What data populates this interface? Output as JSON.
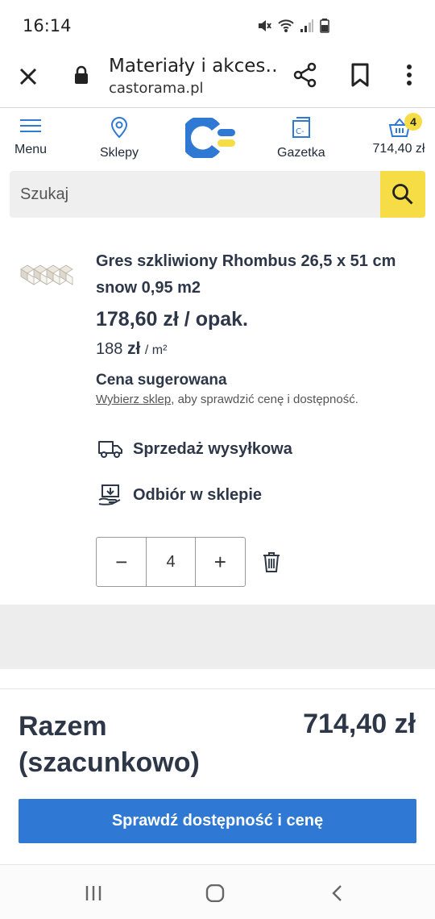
{
  "status_bar": {
    "time": "16:14"
  },
  "browser": {
    "title": "Materiały i akces…",
    "url": "castorama.pl"
  },
  "nav": {
    "menu": "Menu",
    "stores": "Sklepy",
    "gazette": "Gazetka",
    "cart_total": "714,40 zł",
    "cart_count": "4"
  },
  "search": {
    "placeholder": "Szukaj"
  },
  "product": {
    "name": "Gres szkliwiony Rhombus 26,5 x 51 cm snow 0,95 m2",
    "price": "178,60 zł / opak.",
    "unit_price_value": "188",
    "unit_price_currency": "zł",
    "unit_price_unit": "/ m²",
    "suggested_label": "Cena sugerowana",
    "select_store_link": "Wybierz sklep",
    "select_store_note": ", aby sprawdzić cenę i dostępność.",
    "delivery_label": "Sprzedaż wysyłkowa",
    "pickup_label": "Odbiór w sklepie",
    "quantity": "4",
    "minus_symbol": "−",
    "plus_symbol": "+"
  },
  "summary": {
    "label_line1": "Razem",
    "label_line2": "(szacunkowo)",
    "total": "714,40 zł",
    "button": "Sprawdź dostępność i cenę"
  },
  "colors": {
    "brand_blue": "#2f78d4",
    "brand_yellow": "#f6dc45",
    "text_dark": "#2d3748"
  }
}
